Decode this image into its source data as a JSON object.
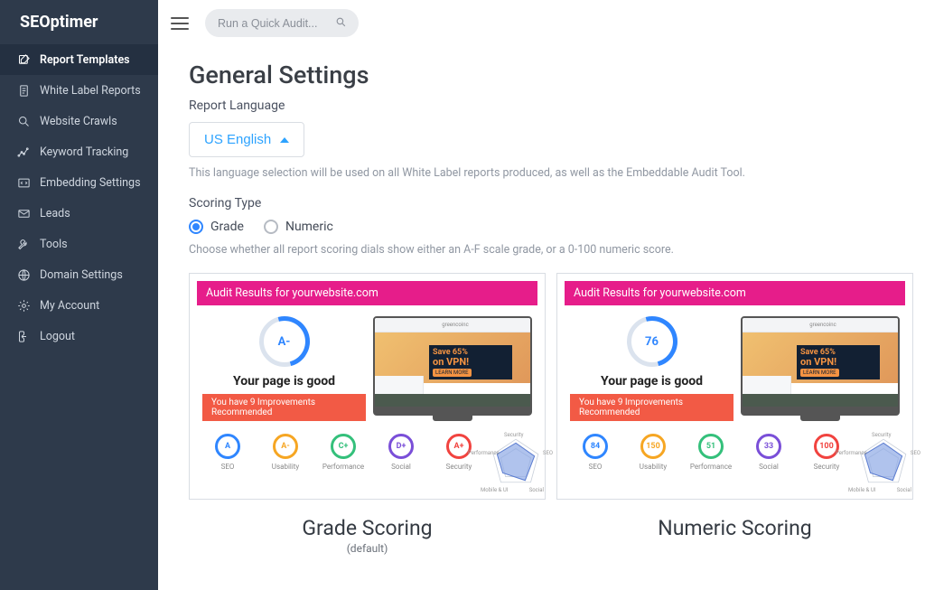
{
  "brand": "SEOptimer",
  "search": {
    "placeholder": "Run a Quick Audit..."
  },
  "sidebar": {
    "items": [
      {
        "label": "Report Templates"
      },
      {
        "label": "White Label Reports"
      },
      {
        "label": "Website Crawls"
      },
      {
        "label": "Keyword Tracking"
      },
      {
        "label": "Embedding Settings"
      },
      {
        "label": "Leads"
      },
      {
        "label": "Tools"
      },
      {
        "label": "Domain Settings"
      },
      {
        "label": "My Account"
      },
      {
        "label": "Logout"
      }
    ]
  },
  "page": {
    "title": "General Settings",
    "report_language_label": "Report Language",
    "report_language_value": "US English",
    "report_language_help": "This language selection will be used on all White Label reports produced, as well as the Embeddable Audit Tool.",
    "scoring_type_label": "Scoring Type",
    "scoring_help": "Choose whether all report scoring dials show either an A-F scale grade, or a 0-100 numeric score.",
    "radios": {
      "grade": "Grade",
      "numeric": "Numeric",
      "selected": "grade"
    }
  },
  "preview": {
    "header": "Audit Results for yourwebsite.com",
    "good": "Your page is good",
    "improve": "You have 9 Improvements Recommended",
    "monitor_brand": "greencoinc",
    "monitor_save": "Save 65%",
    "monitor_vpn": "on VPN!",
    "monitor_cta": "LEARN MORE",
    "metrics_labels": [
      "SEO",
      "Usability",
      "Performance",
      "Social",
      "Security"
    ],
    "radar_labels": [
      "Security",
      "SEO",
      "Social",
      "Mobile & UI",
      "Performance"
    ],
    "grade": {
      "main": "A-",
      "values": [
        "A",
        "A-",
        "C+",
        "D+",
        "A+"
      ],
      "colors": [
        "#2f86ff",
        "#f6a623",
        "#34c07b",
        "#7a4fd8",
        "#f1433f"
      ]
    },
    "numeric": {
      "main": "76",
      "values": [
        "84",
        "150",
        "51",
        "33",
        "100"
      ],
      "colors": [
        "#2f86ff",
        "#f6a623",
        "#34c07b",
        "#7a4fd8",
        "#f1433f"
      ]
    }
  },
  "captions": {
    "grade": "Grade Scoring",
    "grade_sub": "(default)",
    "numeric": "Numeric Scoring"
  }
}
